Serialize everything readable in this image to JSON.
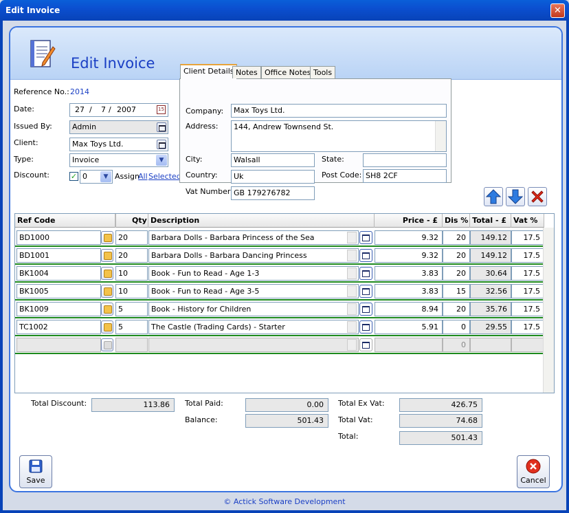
{
  "window": {
    "title": "Edit Invoice",
    "close_glyph": "✕"
  },
  "header": {
    "title": "Edit Invoice",
    "icon": "invoice-document-icon"
  },
  "form": {
    "reference_label": "Reference No.:",
    "reference_value": "2014",
    "date_label": "Date:",
    "date_day": "27",
    "date_month": "7",
    "date_year": "2007",
    "date_sep": "/",
    "issued_by_label": "Issued By:",
    "issued_by_value": "Admin",
    "client_label": "Client:",
    "client_value": "Max Toys Ltd.",
    "type_label": "Type:",
    "type_value": "Invoice",
    "discount_label": "Discount:",
    "discount_value": "0",
    "discount_checked": true,
    "assign_label": "Assign",
    "assign_all": "All",
    "assign_selected": "Selected"
  },
  "tabs": [
    "Client Details",
    "Notes",
    "Office Notes",
    "Tools"
  ],
  "client_details": {
    "company_label": "Company:",
    "company": "Max Toys Ltd.",
    "address_label": "Address:",
    "address": "144, Andrew Townsend St.",
    "city_label": "City:",
    "city": "Walsall",
    "state_label": "State:",
    "state": "",
    "country_label": "Country:",
    "country": "Uk",
    "postcode_label": "Post Code:",
    "postcode": "SH8 2CF",
    "vat_label": "Vat Number:",
    "vat": "GB 179276782"
  },
  "grid": {
    "columns": [
      "Ref Code",
      "Qty",
      "Description",
      "Price - £",
      "Dis %",
      "Total - £",
      "Vat %"
    ],
    "rows": [
      {
        "ref": "BD1000",
        "qty": "20",
        "desc": "Barbara Dolls - Barbara Princess of the Sea",
        "price": "9.32",
        "dis": "20",
        "total": "149.12",
        "vat": "17.5"
      },
      {
        "ref": "BD1001",
        "qty": "20",
        "desc": "Barbara Dolls - Barbara Dancing Princess",
        "price": "9.32",
        "dis": "20",
        "total": "149.12",
        "vat": "17.5"
      },
      {
        "ref": "BK1004",
        "qty": "10",
        "desc": "Book - Fun to Read - Age 1-3",
        "price": "3.83",
        "dis": "20",
        "total": "30.64",
        "vat": "17.5"
      },
      {
        "ref": "BK1005",
        "qty": "10",
        "desc": "Book - Fun to Read - Age 3-5",
        "price": "3.83",
        "dis": "15",
        "total": "32.56",
        "vat": "17.5"
      },
      {
        "ref": "BK1009",
        "qty": "5",
        "desc": "Book - History for Children",
        "price": "8.94",
        "dis": "20",
        "total": "35.76",
        "vat": "17.5"
      },
      {
        "ref": "TC1002",
        "qty": "5",
        "desc": "The Castle (Trading Cards) - Starter",
        "price": "5.91",
        "dis": "0",
        "total": "29.55",
        "vat": "17.5"
      },
      {
        "ref": "",
        "qty": "",
        "desc": "",
        "price": "",
        "dis": "0",
        "total": "",
        "vat": ""
      }
    ]
  },
  "totals": {
    "total_discount_label": "Total Discount:",
    "total_discount": "113.86",
    "total_paid_label": "Total Paid:",
    "total_paid": "0.00",
    "balance_label": "Balance:",
    "balance": "501.43",
    "total_ex_vat_label": "Total Ex Vat:",
    "total_ex_vat": "426.75",
    "total_vat_label": "Total Vat:",
    "total_vat": "74.68",
    "total_label": "Total:",
    "total": "501.43"
  },
  "buttons": {
    "save": "Save",
    "cancel": "Cancel"
  },
  "footer": "© Actick Software Development",
  "colors": {
    "accent": "#1a3fc4",
    "row_separator": "#1d8a1d",
    "titlebar": "#0b4fd0"
  }
}
